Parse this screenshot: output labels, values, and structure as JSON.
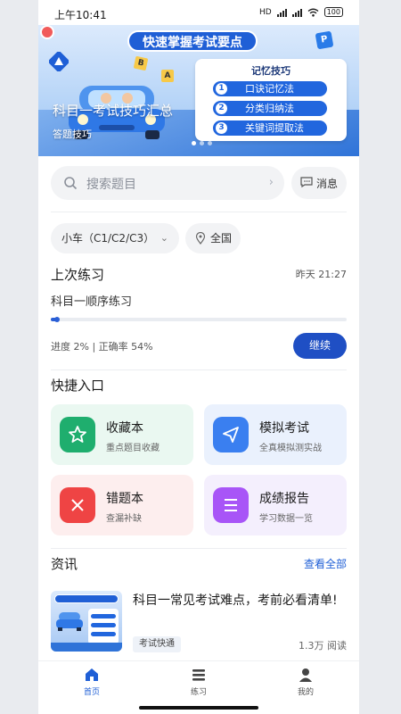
{
  "status_bar": {
    "time": "上午10:41",
    "network_label": "HD",
    "battery": "100"
  },
  "banner": {
    "pill_text": "快速掌握考试要点",
    "card_title": "记忆技巧",
    "tips": [
      {
        "num": "1",
        "label": "口诀记忆法"
      },
      {
        "num": "2",
        "label": "分类归纳法"
      },
      {
        "num": "3",
        "label": "关键词提取法"
      }
    ],
    "title": "科目一考试技巧汇总",
    "subtitle": "答题技巧",
    "slide_count": 3,
    "active_slide": 1
  },
  "search": {
    "placeholder": "搜索题目",
    "message_label": "消息"
  },
  "filters": {
    "vehicle": "小车（C1/C2/C3）",
    "region": "全国"
  },
  "last_practice": {
    "title": "上次练习",
    "time": "昨天 21:27",
    "subject": "科目一顺序练习",
    "progress_fraction": 0.02,
    "stats": "进度 2% | 正确率 54%",
    "continue_label": "继续"
  },
  "quick": {
    "title": "快捷入口",
    "items": [
      {
        "title": "收藏本",
        "subtitle": "重点题目收藏",
        "icon": "star-icon",
        "bg": "#eaf8f1",
        "icon_bg": "#1fae6e"
      },
      {
        "title": "模拟考试",
        "subtitle": "全真模拟测实战",
        "icon": "send-icon",
        "bg": "#eaf1fd",
        "icon_bg": "#3a7ff0"
      },
      {
        "title": "错题本",
        "subtitle": "查漏补缺",
        "icon": "close-icon",
        "bg": "#fdeeee",
        "icon_bg": "#ef4444"
      },
      {
        "title": "成绩报告",
        "subtitle": "学习数据一览",
        "icon": "list-icon",
        "bg": "#f4effd",
        "icon_bg": "#a855f7"
      }
    ]
  },
  "news": {
    "title": "资讯",
    "more_label": "查看全部",
    "item": {
      "title": "科目一常见考试难点，考前必看清单!",
      "tag": "考试快通",
      "views": "1.3万 阅读"
    }
  },
  "tabbar": {
    "items": [
      {
        "label": "首页",
        "icon": "home-icon",
        "active": true
      },
      {
        "label": "练习",
        "icon": "menu-icon",
        "active": false
      },
      {
        "label": "我的",
        "icon": "person-icon",
        "active": false
      }
    ]
  },
  "colors": {
    "accent": "#1f4fc4",
    "link": "#1f5fd6"
  }
}
